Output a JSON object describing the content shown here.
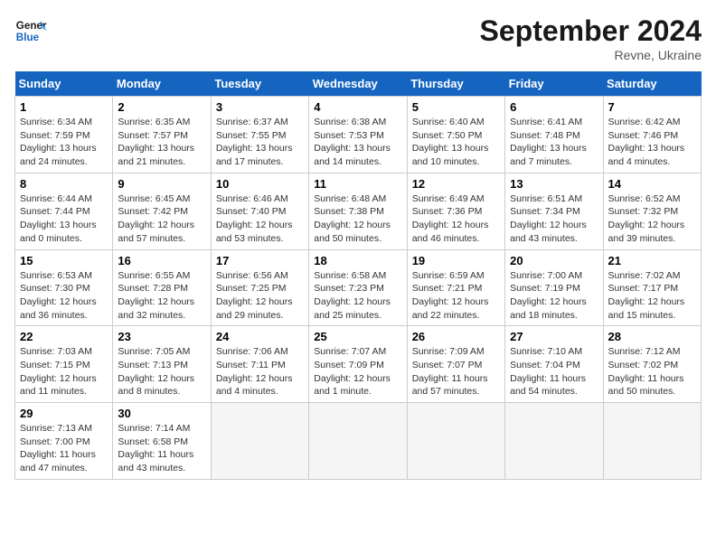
{
  "header": {
    "logo_line1": "General",
    "logo_line2": "Blue",
    "month_title": "September 2024",
    "subtitle": "Revne, Ukraine"
  },
  "weekdays": [
    "Sunday",
    "Monday",
    "Tuesday",
    "Wednesday",
    "Thursday",
    "Friday",
    "Saturday"
  ],
  "days": [
    {
      "num": "",
      "info": ""
    },
    {
      "num": "",
      "info": ""
    },
    {
      "num": "",
      "info": ""
    },
    {
      "num": "",
      "info": ""
    },
    {
      "num": "",
      "info": ""
    },
    {
      "num": "",
      "info": ""
    },
    {
      "num": "",
      "info": ""
    },
    {
      "num": "1",
      "info": "Sunrise: 6:34 AM\nSunset: 7:59 PM\nDaylight: 13 hours\nand 24 minutes."
    },
    {
      "num": "2",
      "info": "Sunrise: 6:35 AM\nSunset: 7:57 PM\nDaylight: 13 hours\nand 21 minutes."
    },
    {
      "num": "3",
      "info": "Sunrise: 6:37 AM\nSunset: 7:55 PM\nDaylight: 13 hours\nand 17 minutes."
    },
    {
      "num": "4",
      "info": "Sunrise: 6:38 AM\nSunset: 7:53 PM\nDaylight: 13 hours\nand 14 minutes."
    },
    {
      "num": "5",
      "info": "Sunrise: 6:40 AM\nSunset: 7:50 PM\nDaylight: 13 hours\nand 10 minutes."
    },
    {
      "num": "6",
      "info": "Sunrise: 6:41 AM\nSunset: 7:48 PM\nDaylight: 13 hours\nand 7 minutes."
    },
    {
      "num": "7",
      "info": "Sunrise: 6:42 AM\nSunset: 7:46 PM\nDaylight: 13 hours\nand 4 minutes."
    },
    {
      "num": "8",
      "info": "Sunrise: 6:44 AM\nSunset: 7:44 PM\nDaylight: 13 hours\nand 0 minutes."
    },
    {
      "num": "9",
      "info": "Sunrise: 6:45 AM\nSunset: 7:42 PM\nDaylight: 12 hours\nand 57 minutes."
    },
    {
      "num": "10",
      "info": "Sunrise: 6:46 AM\nSunset: 7:40 PM\nDaylight: 12 hours\nand 53 minutes."
    },
    {
      "num": "11",
      "info": "Sunrise: 6:48 AM\nSunset: 7:38 PM\nDaylight: 12 hours\nand 50 minutes."
    },
    {
      "num": "12",
      "info": "Sunrise: 6:49 AM\nSunset: 7:36 PM\nDaylight: 12 hours\nand 46 minutes."
    },
    {
      "num": "13",
      "info": "Sunrise: 6:51 AM\nSunset: 7:34 PM\nDaylight: 12 hours\nand 43 minutes."
    },
    {
      "num": "14",
      "info": "Sunrise: 6:52 AM\nSunset: 7:32 PM\nDaylight: 12 hours\nand 39 minutes."
    },
    {
      "num": "15",
      "info": "Sunrise: 6:53 AM\nSunset: 7:30 PM\nDaylight: 12 hours\nand 36 minutes."
    },
    {
      "num": "16",
      "info": "Sunrise: 6:55 AM\nSunset: 7:28 PM\nDaylight: 12 hours\nand 32 minutes."
    },
    {
      "num": "17",
      "info": "Sunrise: 6:56 AM\nSunset: 7:25 PM\nDaylight: 12 hours\nand 29 minutes."
    },
    {
      "num": "18",
      "info": "Sunrise: 6:58 AM\nSunset: 7:23 PM\nDaylight: 12 hours\nand 25 minutes."
    },
    {
      "num": "19",
      "info": "Sunrise: 6:59 AM\nSunset: 7:21 PM\nDaylight: 12 hours\nand 22 minutes."
    },
    {
      "num": "20",
      "info": "Sunrise: 7:00 AM\nSunset: 7:19 PM\nDaylight: 12 hours\nand 18 minutes."
    },
    {
      "num": "21",
      "info": "Sunrise: 7:02 AM\nSunset: 7:17 PM\nDaylight: 12 hours\nand 15 minutes."
    },
    {
      "num": "22",
      "info": "Sunrise: 7:03 AM\nSunset: 7:15 PM\nDaylight: 12 hours\nand 11 minutes."
    },
    {
      "num": "23",
      "info": "Sunrise: 7:05 AM\nSunset: 7:13 PM\nDaylight: 12 hours\nand 8 minutes."
    },
    {
      "num": "24",
      "info": "Sunrise: 7:06 AM\nSunset: 7:11 PM\nDaylight: 12 hours\nand 4 minutes."
    },
    {
      "num": "25",
      "info": "Sunrise: 7:07 AM\nSunset: 7:09 PM\nDaylight: 12 hours\nand 1 minute."
    },
    {
      "num": "26",
      "info": "Sunrise: 7:09 AM\nSunset: 7:07 PM\nDaylight: 11 hours\nand 57 minutes."
    },
    {
      "num": "27",
      "info": "Sunrise: 7:10 AM\nSunset: 7:04 PM\nDaylight: 11 hours\nand 54 minutes."
    },
    {
      "num": "28",
      "info": "Sunrise: 7:12 AM\nSunset: 7:02 PM\nDaylight: 11 hours\nand 50 minutes."
    },
    {
      "num": "29",
      "info": "Sunrise: 7:13 AM\nSunset: 7:00 PM\nDaylight: 11 hours\nand 47 minutes."
    },
    {
      "num": "30",
      "info": "Sunrise: 7:14 AM\nSunset: 6:58 PM\nDaylight: 11 hours\nand 43 minutes."
    },
    {
      "num": "",
      "info": ""
    },
    {
      "num": "",
      "info": ""
    },
    {
      "num": "",
      "info": ""
    },
    {
      "num": "",
      "info": ""
    },
    {
      "num": "",
      "info": ""
    }
  ]
}
